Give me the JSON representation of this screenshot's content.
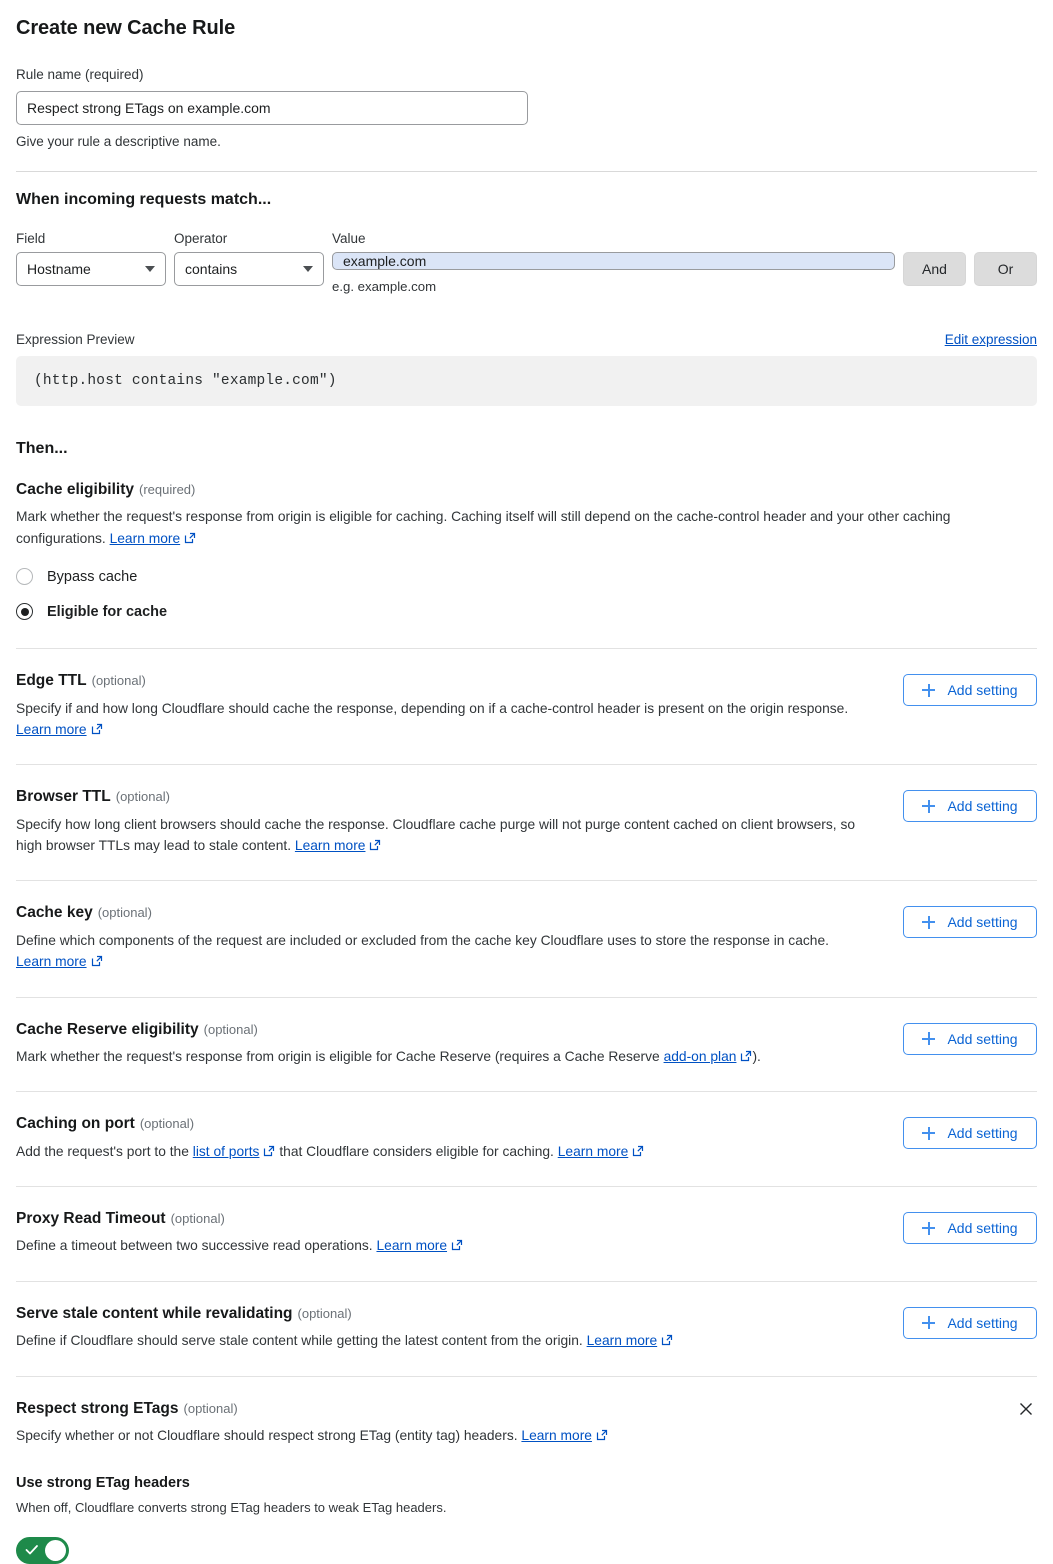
{
  "page": {
    "title": "Create new Cache Rule"
  },
  "rule_name": {
    "label": "Rule name (required)",
    "value": "Respect strong ETags on example.com",
    "placeholder": "Rule name",
    "helper": "Give your rule a descriptive name."
  },
  "match": {
    "heading": "When incoming requests match...",
    "field_label": "Field",
    "operator_label": "Operator",
    "value_label": "Value",
    "field_value": "Hostname",
    "operator_value": "contains",
    "value_value": "example.com",
    "value_placeholder": "Enter value",
    "value_hint": "e.g. example.com",
    "and_label": "And",
    "or_label": "Or"
  },
  "expression": {
    "label": "Expression Preview",
    "edit_link": "Edit expression",
    "text": "(http.host contains \"example.com\")"
  },
  "then": {
    "heading": "Then..."
  },
  "cache_eligibility": {
    "title": "Cache eligibility",
    "tag": "(required)",
    "desc_before": "Mark whether the request's response from origin is eligible for caching. Caching itself will still depend on the cache-control header and your other caching configurations.",
    "learn_more": "Learn more",
    "options": [
      {
        "label": "Bypass cache",
        "selected": false
      },
      {
        "label": "Eligible for cache",
        "selected": true
      }
    ]
  },
  "settings": [
    {
      "title": "Edge TTL",
      "tag": "(optional)",
      "desc_before": "Specify if and how long Cloudflare should cache the response, depending on if a cache-control header is present on the origin response.",
      "link_text": "Learn more",
      "desc_after": "",
      "button": "Add setting"
    },
    {
      "title": "Browser TTL",
      "tag": "(optional)",
      "desc_before": "Specify how long client browsers should cache the response. Cloudflare cache purge will not purge content cached on client browsers, so high browser TTLs may lead to stale content.",
      "link_text": "Learn more",
      "desc_after": "",
      "button": "Add setting"
    },
    {
      "title": "Cache key",
      "tag": "(optional)",
      "desc_before": "Define which components of the request are included or excluded from the cache key Cloudflare uses to store the response in cache.",
      "link_text": "Learn more",
      "desc_after": "",
      "button": "Add setting"
    },
    {
      "title": "Cache Reserve eligibility",
      "tag": "(optional)",
      "desc_before": "Mark whether the request's response from origin is eligible for Cache Reserve (requires a Cache Reserve",
      "link_text": "add-on plan",
      "desc_after": ").",
      "button": "Add setting"
    },
    {
      "title": "Caching on port",
      "tag": "(optional)",
      "desc_before": "Add the request's port to the",
      "link_text": "list of ports",
      "desc_after": "that Cloudflare considers eligible for caching.",
      "link_text2": "Learn more",
      "button": "Add setting"
    },
    {
      "title": "Proxy Read Timeout",
      "tag": "(optional)",
      "desc_before": "Define a timeout between two successive read operations.",
      "link_text": "Learn more",
      "desc_after": "",
      "button": "Add setting"
    },
    {
      "title": "Serve stale content while revalidating",
      "tag": "(optional)",
      "desc_before": "Define if Cloudflare should serve stale content while getting the latest content from the origin.",
      "link_text": "Learn more",
      "desc_after": "",
      "button": "Add setting"
    }
  ],
  "etags": {
    "title": "Respect strong ETags",
    "tag": "(optional)",
    "desc_before": "Specify whether or not Cloudflare should respect strong ETag (entity tag) headers.",
    "learn_more": "Learn more",
    "toggle_label": "Use strong ETag headers",
    "toggle_desc": "When off, Cloudflare converts strong ETag headers to weak ETag headers.",
    "toggle_on": true
  },
  "colors": {
    "link": "#0051c3",
    "button_blue": "#0b64d4",
    "toggle_green": "#1e8a4a",
    "value_highlight": "#dbe5f7"
  }
}
